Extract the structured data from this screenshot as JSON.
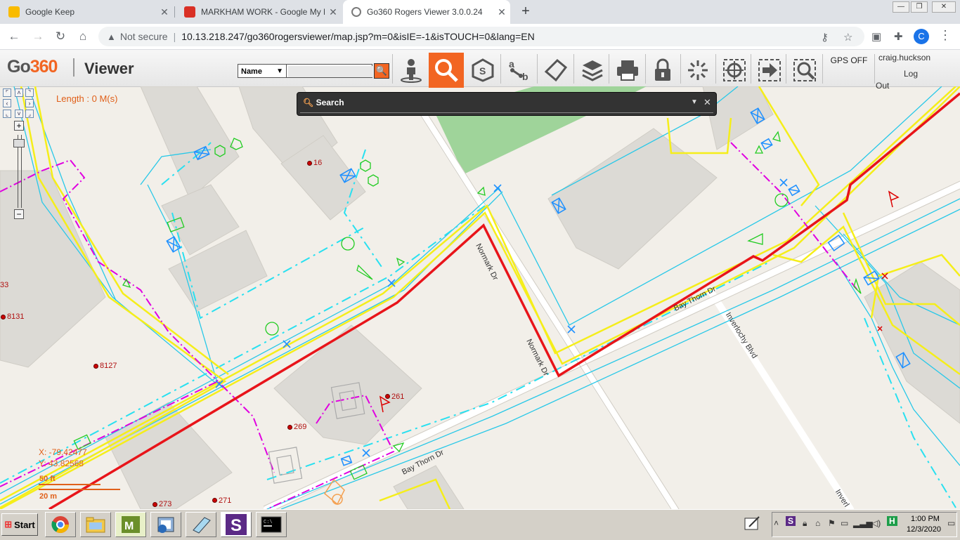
{
  "browser": {
    "tabs": [
      {
        "title": "Google Keep",
        "favicon_color": "#f9bb00"
      },
      {
        "title": "MARKHAM WORK - Google My Maps",
        "favicon_color": "#d93025"
      },
      {
        "title": "Go360 Rogers Viewer 3.0.0.24",
        "favicon_color": "#7a7a7a"
      }
    ],
    "active_tab_index": 2,
    "new_tab_icon": "plus-icon",
    "address": {
      "security_label": "Not secure",
      "url": "10.13.218.247/go360rogersviewer/map.jsp?m=0&isIE=-1&isTOUCH=0&lang=EN"
    },
    "profile_initial": "C"
  },
  "app": {
    "logo_go": "Go",
    "logo_num": "360",
    "title": "Viewer",
    "search_type": "Name",
    "search_value": "",
    "toolbar_icons": [
      "locate-person-icon",
      "search-icon",
      "select-shape-icon",
      "measure-icon",
      "polygon-icon",
      "layers-icon",
      "print-icon",
      "lock-icon",
      "explode-icon",
      "target-icon",
      "export-icon",
      "zoom-search-icon"
    ],
    "active_tool": "search-icon",
    "gps_label": "GPS OFF",
    "user": "craig.huckson",
    "logout_part1": "Log",
    "logout_part2": "Out",
    "accent": "#f26522"
  },
  "map": {
    "length_label": "Length : 0 M(s)",
    "coord_x": "X:   -79.42477",
    "coord_y": "Y:   43.82568",
    "scale_imperial": "50 ft",
    "scale_metric": "20 m",
    "search_panel_title": "Search",
    "address_labels": [
      "16",
      "33",
      "8131",
      "8127",
      "261",
      "269",
      "273",
      "271"
    ],
    "road_labels": [
      "Normark Dr",
      "Normark Dr",
      "Bay Thorn Dr",
      "Bay Thorn Dr",
      "Inverlochy Blvd",
      "Inverl"
    ],
    "route_color": "#e8141a",
    "cable_color": "#00c8e6",
    "duct_color": "#f5ee1a"
  },
  "taskbar": {
    "start_label": "Start",
    "apps": [
      "chrome-icon",
      "explorer-icon",
      "mapinfo-icon",
      "outlook-icon",
      "notepad-icon",
      "s-app-icon",
      "cmd-icon"
    ],
    "clock_time": "1:00 PM",
    "clock_date": "12/3/2020"
  }
}
